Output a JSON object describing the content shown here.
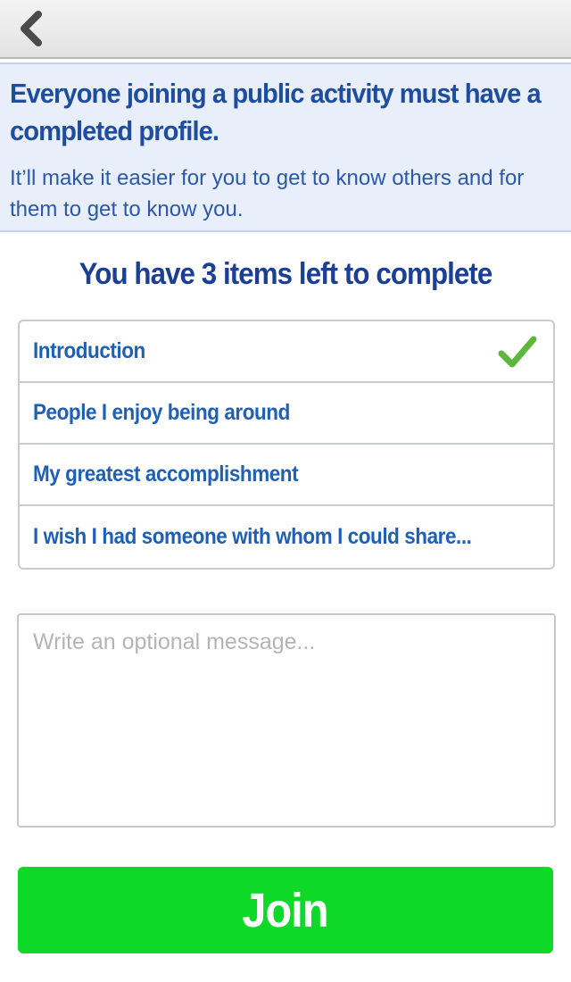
{
  "nav": {
    "back_icon": "chevron-left-icon"
  },
  "banner": {
    "title": "Everyone joining a public activity must have a completed profile.",
    "subtitle": "It’ll make it easier for you to get to know others and for them to get to know you."
  },
  "heading": "You have 3 items left to complete",
  "items": [
    {
      "label": "Introduction",
      "completed": true
    },
    {
      "label": "People I enjoy being around",
      "completed": false
    },
    {
      "label": "My greatest accomplishment",
      "completed": false
    },
    {
      "label": "I wish I had someone with whom I could share...",
      "completed": false
    }
  ],
  "message": {
    "value": "",
    "placeholder": "Write an optional message..."
  },
  "join_button": {
    "label": "Join"
  },
  "colors": {
    "banner_bg": "#e8effb",
    "title_blue": "#1f4d9e",
    "item_blue": "#1f60b5",
    "check_green": "#5cb83c",
    "join_green": "#0fd928"
  }
}
